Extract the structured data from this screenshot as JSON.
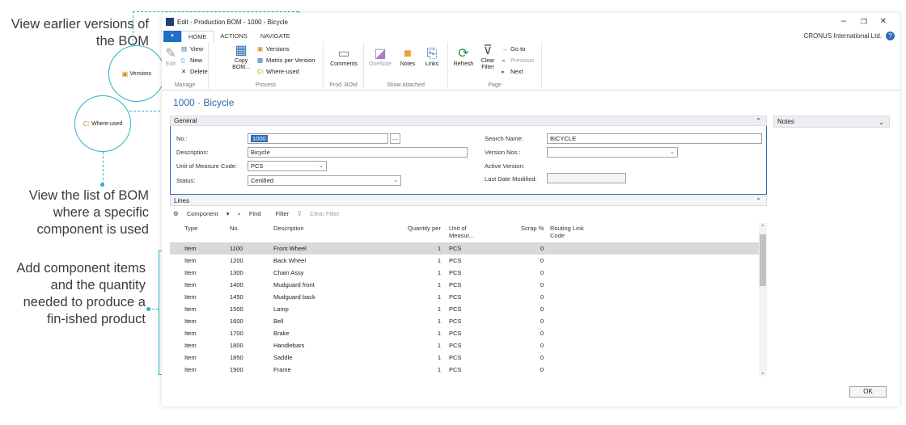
{
  "callouts": {
    "versions": "View earlier versions of the BOM",
    "whereused": "View the list of BOM where a specific component is used",
    "lines": "Add component items and the quantity needed to produce a fin-ished product",
    "versions_circle_label": "Versions",
    "whereused_circle_label": "Where-used"
  },
  "window": {
    "title": "Edit - Production BOM - 1000 - Bicycle",
    "company": "CRONUS International Ltd.",
    "help": "?",
    "minimize": "–",
    "restore": "❐",
    "close": "✕"
  },
  "ribbon": {
    "file_label": "▾",
    "tabs": [
      "HOME",
      "ACTIONS",
      "NAVIGATE"
    ],
    "manage": {
      "label": "Manage",
      "edit": "Edit",
      "view": "View",
      "new": "New",
      "delete": "Delete"
    },
    "process": {
      "label": "Process",
      "copy_bom": "Copy BOM...",
      "versions": "Versions",
      "matrix": "Matrix per Version",
      "whereused": "Where-used"
    },
    "prod_bom": {
      "label": "Prod. BOM",
      "comments": "Comments"
    },
    "show_attached": {
      "label": "Show Attached",
      "onenote": "OneNote",
      "notes": "Notes",
      "links": "Links"
    },
    "page": {
      "label": "Page",
      "refresh": "Refresh",
      "clear_filter": "Clear Filter",
      "goto": "Go to",
      "previous": "Previous",
      "next": "Next"
    }
  },
  "page_title": "1000 · Bicycle",
  "general": {
    "header": "General",
    "no_label": "No.:",
    "no_value": "1000",
    "description_label": "Description:",
    "description_value": "Bicycle",
    "uom_label": "Unit of Measure Code:",
    "uom_value": "PCS",
    "status_label": "Status:",
    "status_value": "Certified",
    "search_name_label": "Search Name:",
    "search_name_value": "BICYCLE",
    "version_nos_label": "Version Nos.:",
    "version_nos_value": "",
    "active_version_label": "Active Version:",
    "last_modified_label": "Last Date Modified:",
    "last_modified_value": ""
  },
  "notes_panel": {
    "header": "Notes"
  },
  "lines": {
    "header": "Lines",
    "toolbar": {
      "component": "Component",
      "find": "Find",
      "filter": "Filter",
      "clear_filter": "Clear Filter"
    },
    "columns": [
      "Type",
      "No.",
      "Description",
      "Quantity per",
      "Unit of Measur...",
      "Scrap %",
      "Routing Link Code"
    ],
    "rows": [
      {
        "type": "Item",
        "no": "1100",
        "desc": "Front Wheel",
        "qty": "1",
        "uom": "PCS",
        "scrap": "0"
      },
      {
        "type": "Item",
        "no": "1200",
        "desc": "Back Wheel",
        "qty": "1",
        "uom": "PCS",
        "scrap": "0"
      },
      {
        "type": "Item",
        "no": "1300",
        "desc": "Chain Assy",
        "qty": "1",
        "uom": "PCS",
        "scrap": "0"
      },
      {
        "type": "Item",
        "no": "1400",
        "desc": "Mudguard front",
        "qty": "1",
        "uom": "PCS",
        "scrap": "0"
      },
      {
        "type": "Item",
        "no": "1450",
        "desc": "Mudguard back",
        "qty": "1",
        "uom": "PCS",
        "scrap": "0"
      },
      {
        "type": "Item",
        "no": "1500",
        "desc": "Lamp",
        "qty": "1",
        "uom": "PCS",
        "scrap": "0"
      },
      {
        "type": "Item",
        "no": "1600",
        "desc": "Bell",
        "qty": "1",
        "uom": "PCS",
        "scrap": "0"
      },
      {
        "type": "Item",
        "no": "1700",
        "desc": "Brake",
        "qty": "1",
        "uom": "PCS",
        "scrap": "0"
      },
      {
        "type": "Item",
        "no": "1800",
        "desc": "Handlebars",
        "qty": "1",
        "uom": "PCS",
        "scrap": "0"
      },
      {
        "type": "Item",
        "no": "1850",
        "desc": "Saddle",
        "qty": "1",
        "uom": "PCS",
        "scrap": "0"
      },
      {
        "type": "Item",
        "no": "1900",
        "desc": "Frame",
        "qty": "1",
        "uom": "PCS",
        "scrap": "0"
      }
    ]
  },
  "ok_button": "OK"
}
